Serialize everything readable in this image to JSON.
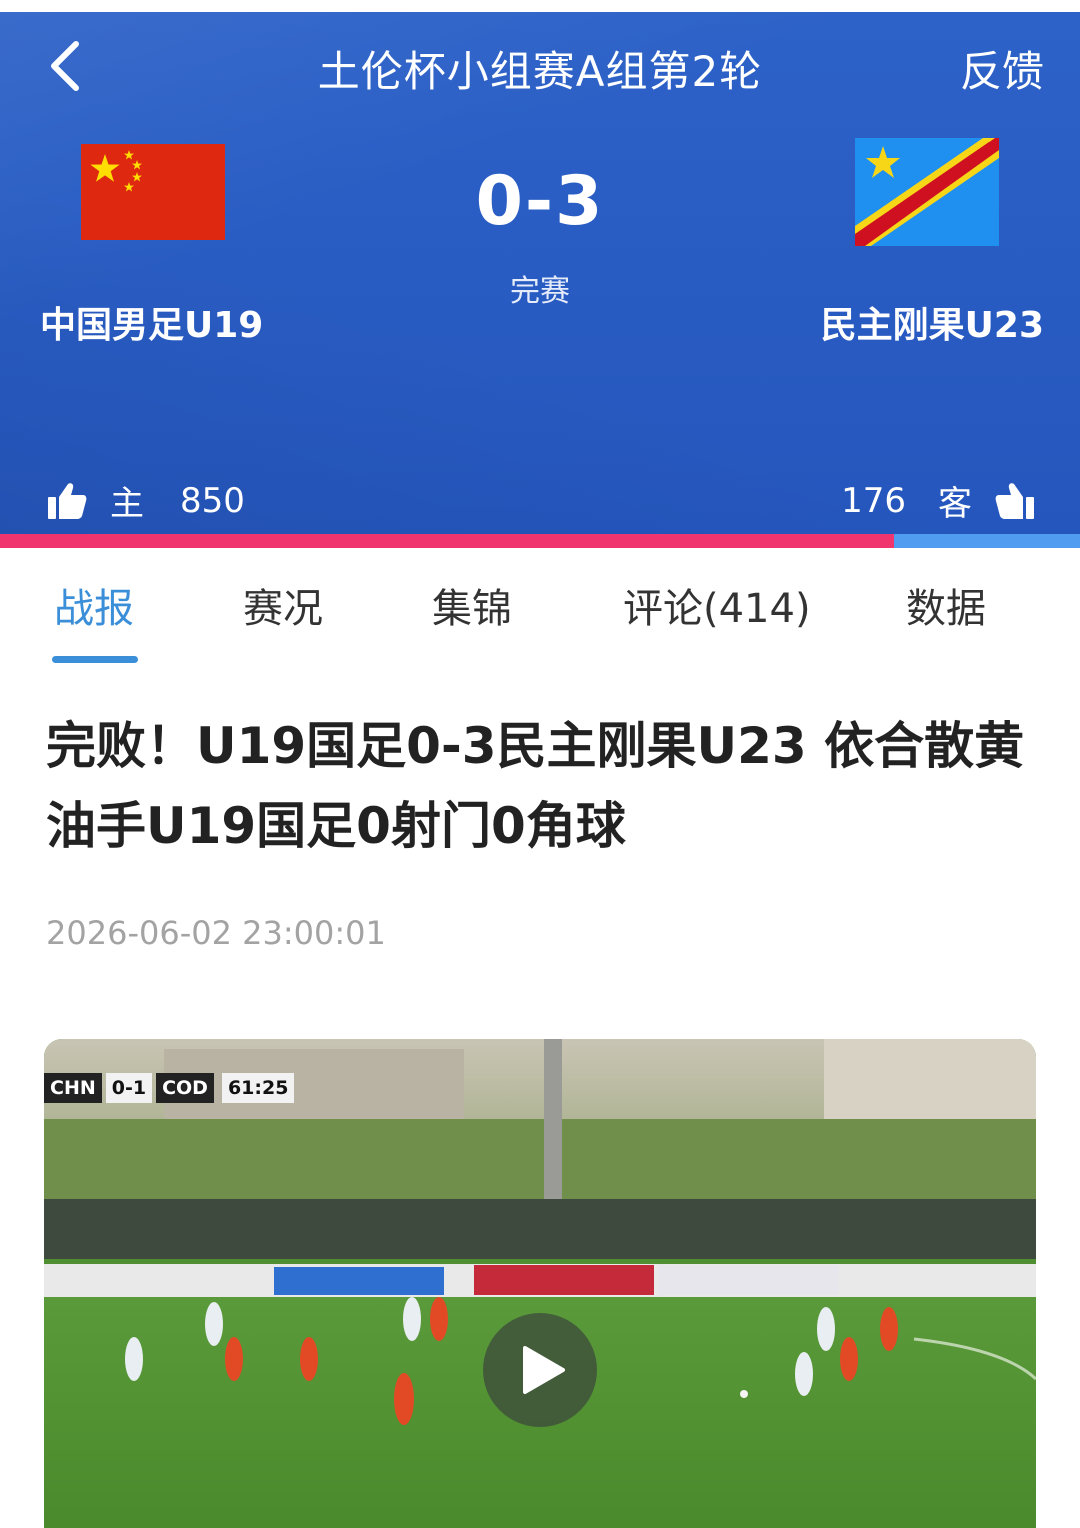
{
  "header": {
    "title": "土伦杯小组赛A组第2轮",
    "feedback_label": "反馈",
    "back_icon": "chevron-left-icon"
  },
  "match": {
    "score": "0-3",
    "status": "完赛",
    "home": {
      "name": "中国男足U19",
      "flag": "china-flag"
    },
    "away": {
      "name": "民主刚果U23",
      "flag": "dr-congo-flag"
    }
  },
  "votes": {
    "home_label": "主",
    "home_count": "850",
    "away_label": "客",
    "away_count": "176",
    "home_fraction": 0.828,
    "home_color": "#f0346e",
    "away_color": "#4f9cf0"
  },
  "tabs": [
    {
      "label": "战报",
      "active": true
    },
    {
      "label": "赛况",
      "active": false
    },
    {
      "label": "集锦",
      "active": false
    },
    {
      "label": "评论(414)",
      "active": false
    },
    {
      "label": "数据",
      "active": false
    }
  ],
  "article": {
    "title": "完败！U19国足0-3民主刚果U23 依合散黄油手U19国足0射门0角球",
    "time": "2026-06-02 23:00:01"
  },
  "video": {
    "scoreboard": {
      "home_code": "CHN",
      "score": "0-1",
      "away_code": "COD",
      "clock": "61:25"
    },
    "play_icon": "play-icon"
  },
  "colors": {
    "header_blue": "#2556bd",
    "accent": "#3b8fd9"
  }
}
